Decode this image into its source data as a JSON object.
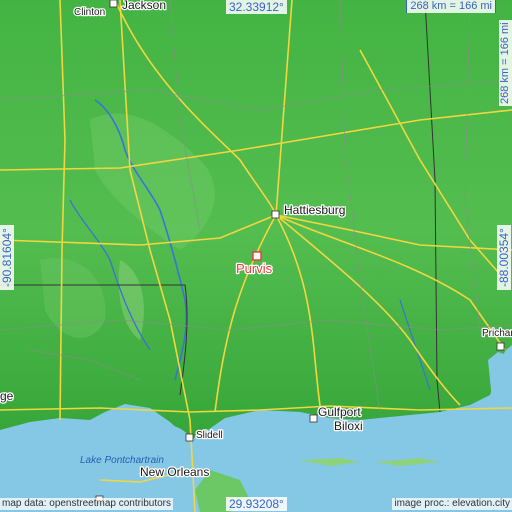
{
  "coords": {
    "top": "32.33912°",
    "bottom": "29.93208°",
    "left": "-90.81604°",
    "right": "-88.00354°"
  },
  "scale": {
    "horizontal": "268 km = 166 mi",
    "vertical": "268 km = 166 mi"
  },
  "credits": {
    "left": "map data: openstreetmap contributors",
    "right": "image proc.: elevation.city"
  },
  "places": {
    "jackson": "Jackson",
    "clinton": "Clinton",
    "hattiesburg": "Hattiesburg",
    "purvis": "Purvis",
    "prichard": "Prichar",
    "gulfport": "Gulfport",
    "biloxi": "Biloxi",
    "slidell": "Slidell",
    "new_orleans": "New Orleans",
    "lake": "Lake Pontchartrain",
    "edge_left": "ge"
  },
  "colors": {
    "water": "#84c8e6",
    "highlight": "#e84040",
    "road": "#f2d640"
  }
}
